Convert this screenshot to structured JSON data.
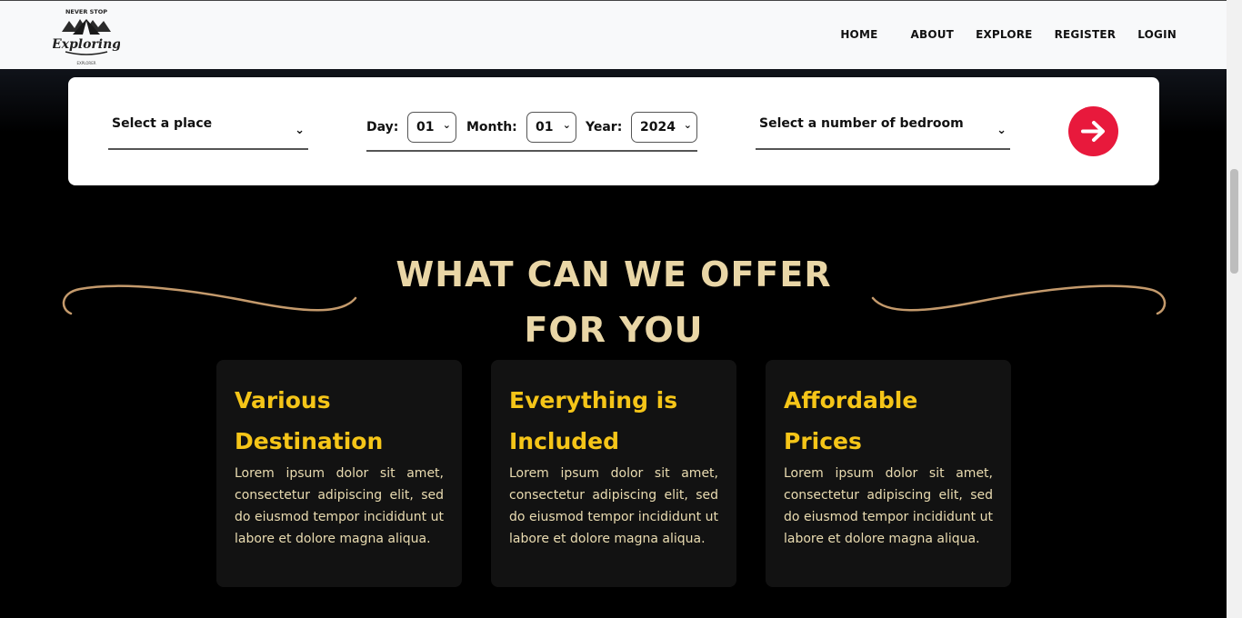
{
  "logo": {
    "top_text": "NEVER STOP",
    "main_text": "Exploring",
    "bottom_text": "EXPLORER"
  },
  "nav": {
    "items": [
      {
        "label": "HOME"
      },
      {
        "label": "ABOUT"
      },
      {
        "label": "EXPLORE"
      },
      {
        "label": "REGISTER"
      },
      {
        "label": "LOGIN"
      }
    ]
  },
  "search": {
    "place": {
      "label": "Select a place"
    },
    "date": {
      "day_label": "Day:",
      "day_value": "01",
      "month_label": "Month:",
      "month_value": "01",
      "year_label": "Year:",
      "year_value": "2024"
    },
    "bedroom": {
      "label": "Select a number of bedroom"
    },
    "submit_icon": "arrow-right-icon"
  },
  "offer": {
    "heading_line1": "WHAT CAN WE OFFER",
    "heading_line2": "FOR YOU",
    "cards": [
      {
        "title_line1": "Various",
        "title_line2": "Destination",
        "text": "Lorem ipsum dolor sit amet, consectetur adipiscing elit, sed do eiusmod tempor incididunt ut labore et dolore magna aliqua."
      },
      {
        "title_line1": "Everything is",
        "title_line2": "Included",
        "text": "Lorem ipsum dolor sit amet, consectetur adipiscing elit, sed do eiusmod tempor incididunt ut labore et dolore magna aliqua."
      },
      {
        "title_line1": "Affordable",
        "title_line2": "Prices",
        "text": "Lorem ipsum dolor sit amet, consectetur adipiscing elit, sed do eiusmod tempor incididunt ut labore et dolore magna aliqua."
      }
    ]
  },
  "colors": {
    "accent": "#e8193c",
    "heading": "#e9d6a6",
    "card_title": "#f5c518",
    "card_text": "#eadcb1",
    "swirl": "#c49a6c"
  }
}
